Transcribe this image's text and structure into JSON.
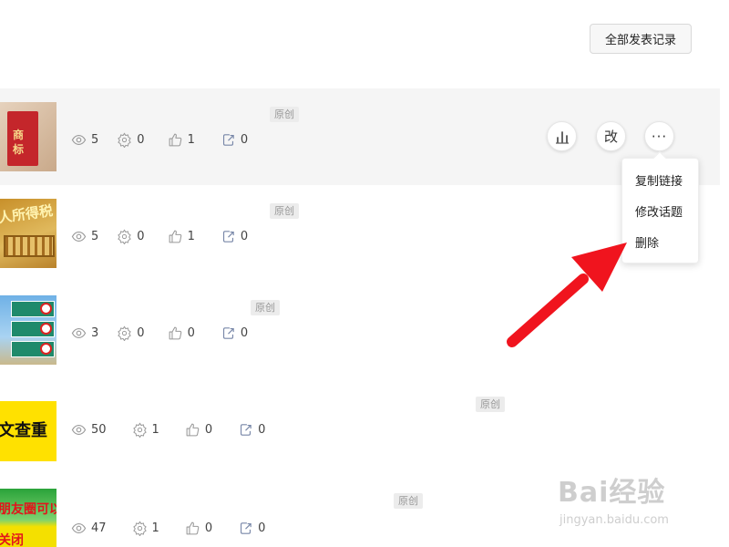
{
  "top_button": {
    "label": "全部发表记录"
  },
  "tag_label": "原创",
  "articles": [
    {
      "thumb_text": "商标",
      "views": "5",
      "shares": "0",
      "likes": "1",
      "forwards": "0"
    },
    {
      "thumb_text": "人所得税",
      "views": "5",
      "shares": "0",
      "likes": "1",
      "forwards": "0"
    },
    {
      "thumb_text": "",
      "views": "3",
      "shares": "0",
      "likes": "0",
      "forwards": "0"
    },
    {
      "thumb_text": "文查重",
      "views": "50",
      "shares": "1",
      "likes": "0",
      "forwards": "0"
    },
    {
      "thumb_text": "朋友圈可以关闭",
      "views": "47",
      "shares": "1",
      "likes": "0",
      "forwards": "0"
    }
  ],
  "actions": {
    "edit_label": "改",
    "more_label": "···"
  },
  "menu": {
    "items": [
      "复制链接",
      "修改话题",
      "删除"
    ]
  },
  "watermark": {
    "logo": "Bai经验",
    "sub": "jingyan.baidu.com"
  },
  "colors": {
    "arrow": "#f0141e",
    "tag_bg": "#ececec",
    "row_highlight": "#f5f5f5"
  }
}
